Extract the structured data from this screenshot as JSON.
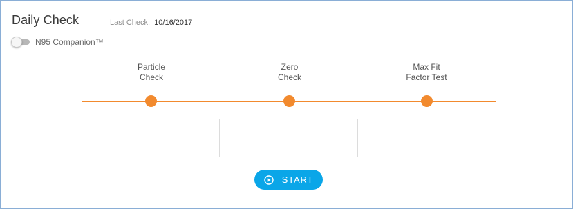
{
  "header": {
    "title": "Daily Check",
    "last_check_label": "Last Check:",
    "last_check_date": "10/16/2017"
  },
  "toggle": {
    "label": "N95 Companion™",
    "enabled": false
  },
  "steps": [
    {
      "label": "Particle\nCheck"
    },
    {
      "label": "Zero\nCheck"
    },
    {
      "label": "Max Fit\nFactor Test"
    }
  ],
  "start_button": {
    "label": "START",
    "icon": "play-circle-icon"
  },
  "colors": {
    "accent_orange": "#f28a2e",
    "button_blue": "#0aa6e8",
    "panel_border": "#8aaed6"
  }
}
